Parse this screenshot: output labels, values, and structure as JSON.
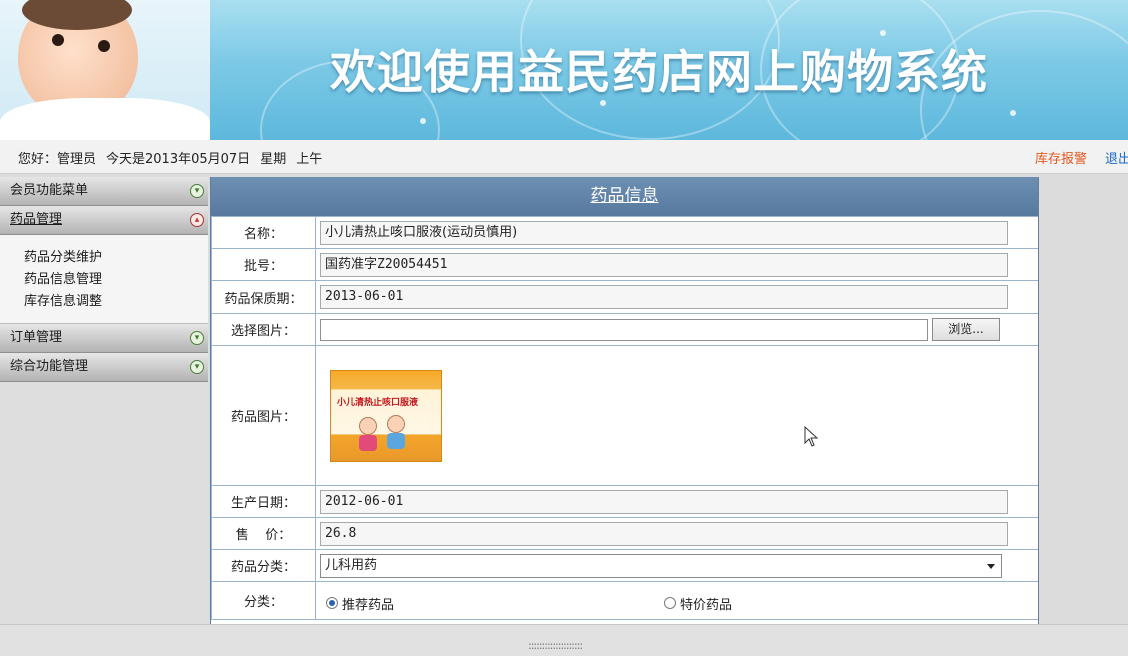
{
  "banner": {
    "title": "欢迎使用益民药店网上购物系统"
  },
  "infobar": {
    "greeting": "您好：管理员",
    "date_text": "今天是2013年05月07日",
    "weekday": "星期",
    "period": "上午",
    "stock_alert_link": "库存报警",
    "logout_link": "退出系"
  },
  "sidebar": {
    "menus": [
      {
        "label": "会员功能菜单"
      },
      {
        "label": "药品管理",
        "items": [
          "药品分类维护",
          "药品信息管理",
          "库存信息调整"
        ]
      },
      {
        "label": "订单管理"
      },
      {
        "label": "综合功能管理"
      }
    ]
  },
  "form": {
    "title": "药品信息",
    "name_label": "名称：",
    "name_value": "小儿清热止咳口服液(运动员慎用)",
    "approval_label": "批号：",
    "approval_value": "国药准字Z20054451",
    "expiry_label": "药品保质期：",
    "expiry_value": "2013-06-01",
    "select_image_label": "选择图片：",
    "browse_button": "浏览...",
    "image_label": "药品图片：",
    "image_product_text": "小儿清热止咳口服液",
    "production_label": "生产日期：",
    "production_value": "2012-06-01",
    "price_label": "售    价：",
    "price_value": "26.8",
    "category_label": "药品分类：",
    "category_value": "儿科用药",
    "type_label": "分类：",
    "type_options": [
      "推荐药品",
      "特价药品"
    ],
    "type_selected": "推荐药品"
  },
  "footer": {
    "grip": "::::::::::::::::::::"
  },
  "colors": {
    "panel_header": "#58799e",
    "stock_link": "#e4581d",
    "logout_link": "#1b6bc7"
  }
}
